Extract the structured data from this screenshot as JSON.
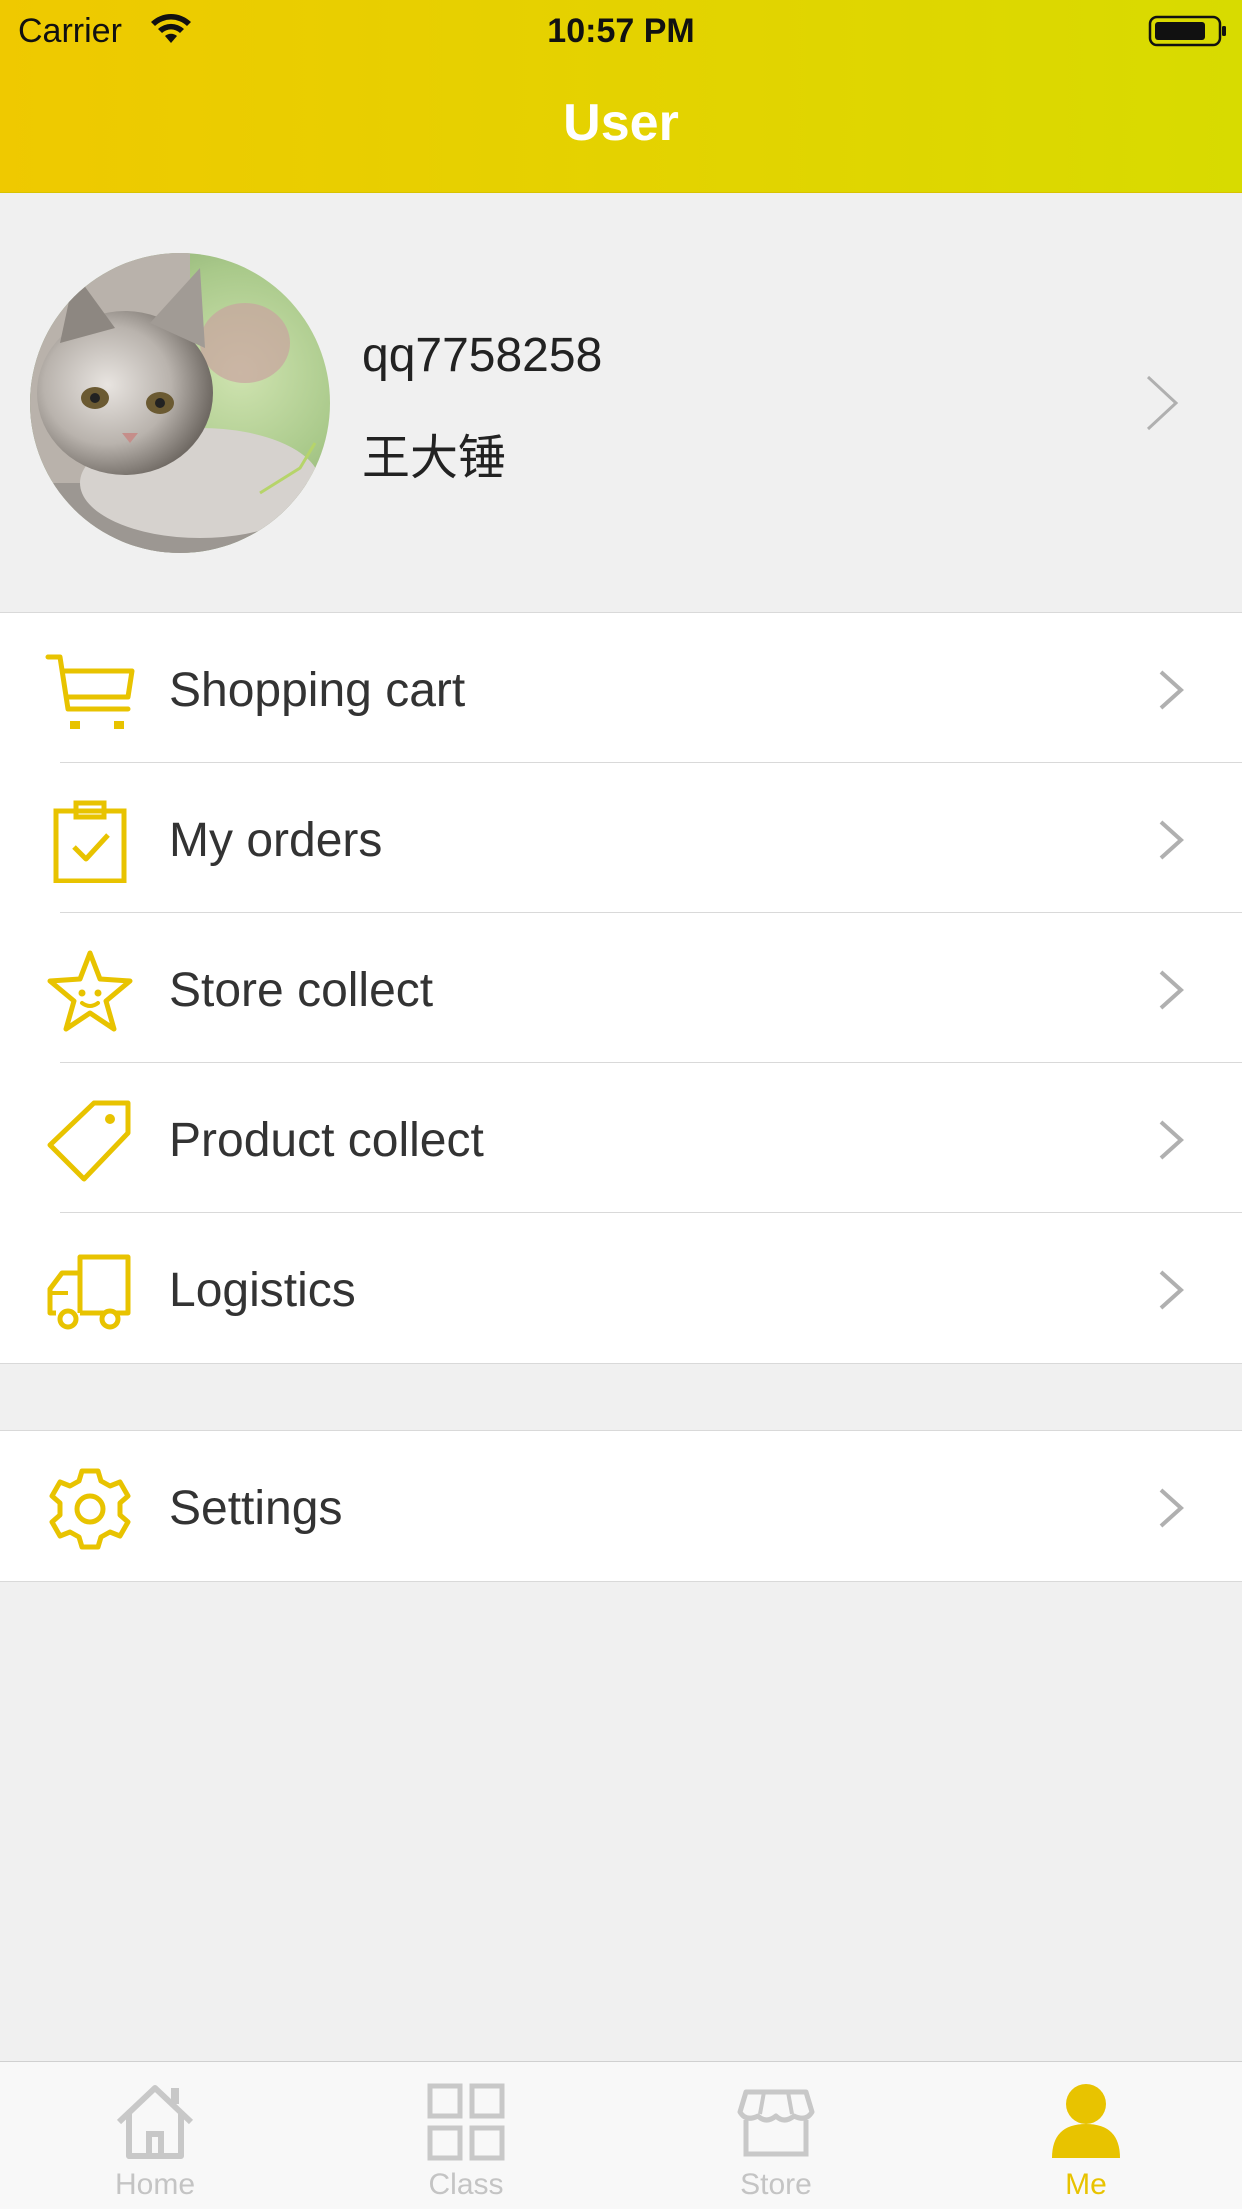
{
  "status_bar": {
    "carrier": "Carrier",
    "time": "10:57 PM"
  },
  "nav": {
    "title": "User"
  },
  "profile": {
    "username": "qq7758258",
    "name": "王大锤"
  },
  "menu": {
    "items": [
      {
        "label": "Shopping cart",
        "icon": "shopping-cart-icon"
      },
      {
        "label": "My orders",
        "icon": "clipboard-check-icon"
      },
      {
        "label": "Store collect",
        "icon": "star-icon"
      },
      {
        "label": "Product collect",
        "icon": "tag-icon"
      },
      {
        "label": "Logistics",
        "icon": "truck-icon"
      }
    ],
    "settings": {
      "label": "Settings",
      "icon": "gear-icon"
    }
  },
  "tabbar": {
    "tabs": [
      {
        "label": "Home",
        "icon": "home-icon"
      },
      {
        "label": "Class",
        "icon": "grid-icon"
      },
      {
        "label": "Store",
        "icon": "store-icon"
      },
      {
        "label": "Me",
        "icon": "person-icon"
      }
    ],
    "active": "Me"
  },
  "colors": {
    "accent": "#e8c300",
    "header_start": "#efc900",
    "header_end": "#d8db00",
    "inactive_tab": "#c4c4c4"
  }
}
